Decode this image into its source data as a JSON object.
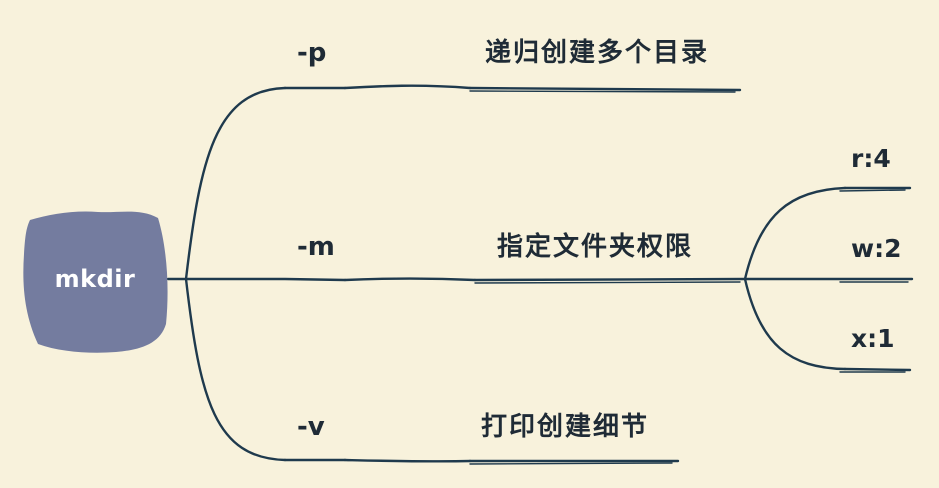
{
  "root": {
    "label": "mkdir"
  },
  "branches": [
    {
      "option": "-p",
      "description": "递归创建多个目录"
    },
    {
      "option": "-m",
      "description": "指定文件夹权限"
    },
    {
      "option": "-v",
      "description": "打印创建细节"
    }
  ],
  "permissions": [
    {
      "label": "r:4"
    },
    {
      "label": "w:2"
    },
    {
      "label": "x:1"
    }
  ],
  "colors": {
    "background": "#f8f2dc",
    "node_fill": "#747c9f",
    "line": "#1f3a4d",
    "text": "#1f2b36"
  }
}
